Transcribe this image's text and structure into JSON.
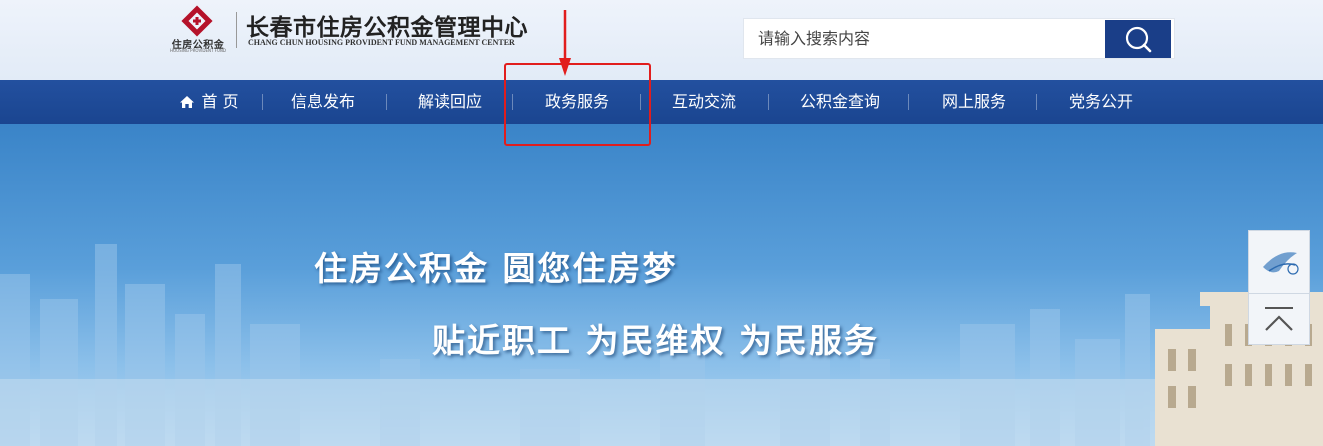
{
  "header": {
    "logo_text": "住房公积金",
    "logo_sub": "HOUSING PROVIDENT FUND",
    "title": "长春市住房公积金管理中心",
    "subtitle": "CHANG CHUN HOUSING PROVIDENT FUND MANAGEMENT CENTER"
  },
  "search": {
    "placeholder": "请输入搜索内容"
  },
  "nav": {
    "home": "首 页",
    "items": [
      "信息发布",
      "解读回应",
      "政务服务",
      "互动交流",
      "公积金查询",
      "网上服务",
      "党务公开"
    ]
  },
  "banner": {
    "slogan1": "住房公积金  圆您住房梦",
    "slogan2": "贴近职工  为民维权  为民服务"
  },
  "colors": {
    "nav_bg": "#1f4a97",
    "search_btn": "#1a3e88",
    "highlight": "#e11d1d",
    "brand_red": "#b5122a"
  },
  "icons": {
    "logo": "housing-fund-logo",
    "search": "search-icon",
    "home": "home-icon",
    "gov": "gov-badge-icon",
    "back_to_top": "chevron-up-icon"
  }
}
